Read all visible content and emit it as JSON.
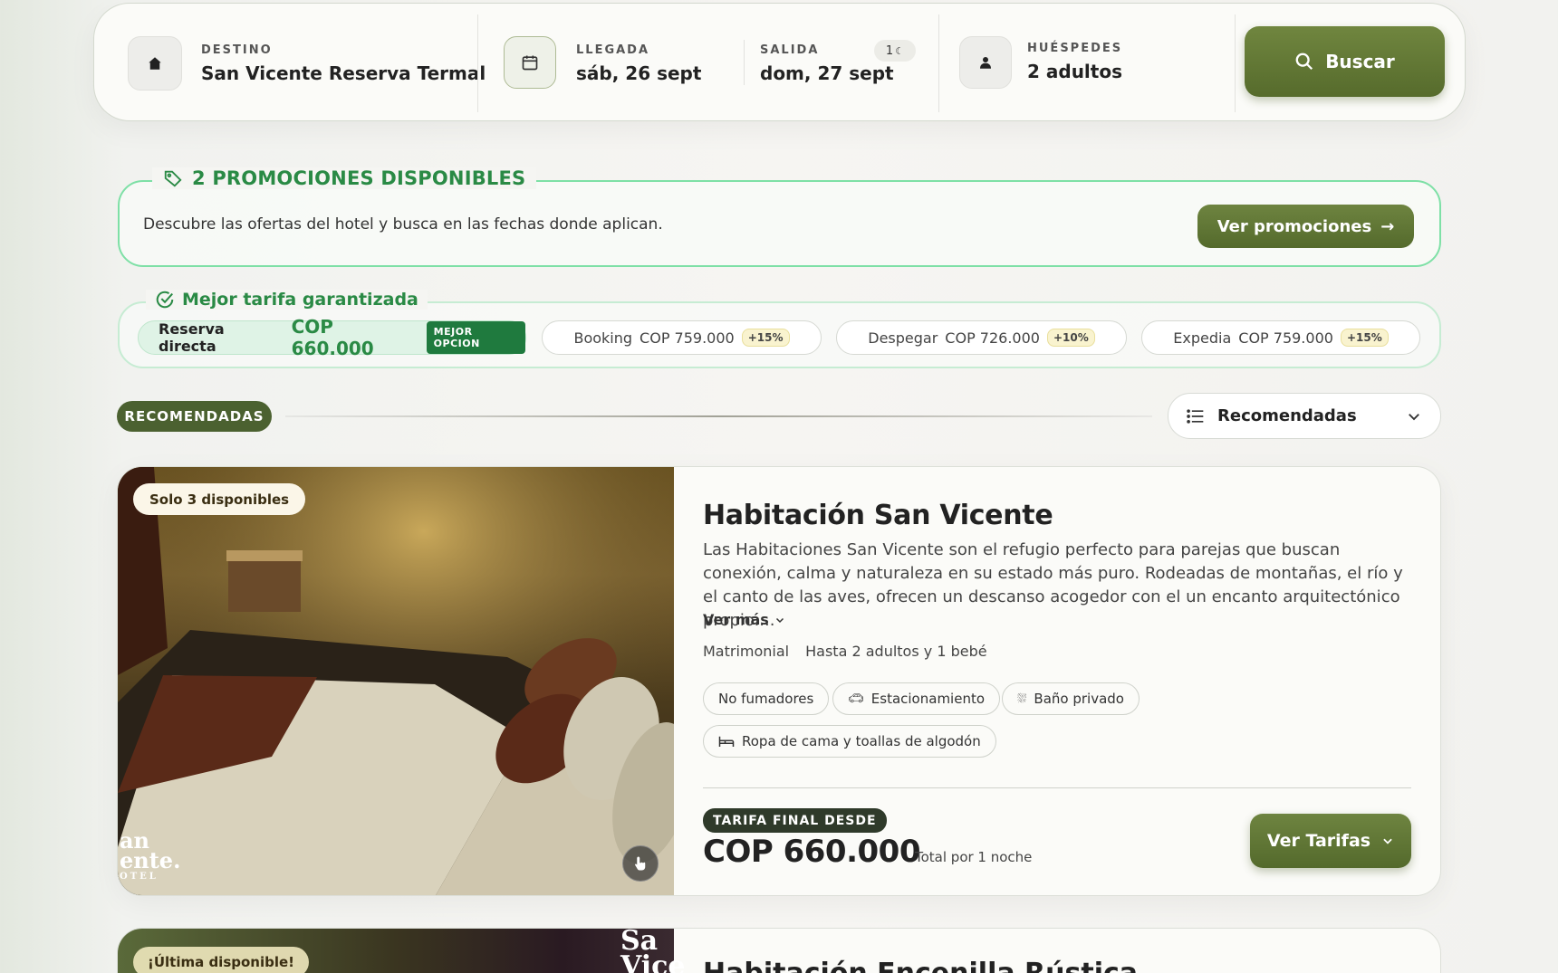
{
  "search": {
    "destination_label": "DESTINO",
    "destination_value": "San Vicente Reserva Termal",
    "arrival_label": "LLEGADA",
    "arrival_value": "sáb, 26 sept",
    "departure_label": "SALIDA",
    "departure_value": "dom, 27 sept",
    "nights": "1",
    "guests_label": "HUÉSPEDES",
    "guests_value": "2 adultos",
    "search_button": "Buscar"
  },
  "promotions": {
    "title": "2 PROMOCIONES DISPONIBLES",
    "description": "Descubre las ofertas del hotel y busca en las fechas donde aplican.",
    "button": "Ver promociones"
  },
  "best_rate": {
    "title": "Mejor tarifa garantizada",
    "direct_label": "Reserva directa",
    "direct_price": "COP 660.000",
    "direct_badge": "MEJOR OPCION",
    "competitors": [
      {
        "name": "Booking",
        "price": "COP 759.000",
        "diff": "+15%"
      },
      {
        "name": "Despegar",
        "price": "COP 726.000",
        "diff": "+10%"
      },
      {
        "name": "Expedia",
        "price": "COP 759.000",
        "diff": "+15%"
      }
    ]
  },
  "section": {
    "badge": "RECOMENDADAS",
    "sort_value": "Recomendadas"
  },
  "room1": {
    "availability": "Solo 3 disponibles",
    "title": "Habitación San Vicente",
    "description": "Las Habitaciones San Vicente son el refugio perfecto para parejas que buscan conexión, calma y naturaleza en su estado más puro. Rodeadas de montañas, el río y el canto de las aves, ofrecen un descanso acogedor con el un encanto arquitectónico propio....",
    "ver_mas": "Ver más",
    "bed": "Matrimonial",
    "capacity": "Hasta 2 adultos y 1 bebé",
    "amenities": [
      "No fumadores",
      "Estacionamiento",
      "Baño privado",
      "Ropa de cama y toallas de algodón"
    ],
    "price_label": "TARIFA FINAL DESDE",
    "price": "COP 660.000",
    "price_note": "Total por 1 noche",
    "button": "Ver Tarifas",
    "watermark_lines": [
      "an",
      "ente.",
      "OTEL"
    ]
  },
  "room2": {
    "availability": "¡Última disponible!",
    "title": "Habitación Encenilla Rústica",
    "watermark_lines": [
      "Sa",
      "Vice"
    ]
  },
  "colors": {
    "primary_green": "#5f7535",
    "accent_green": "#2a8a45",
    "promo_border": "#7ee0a6"
  }
}
